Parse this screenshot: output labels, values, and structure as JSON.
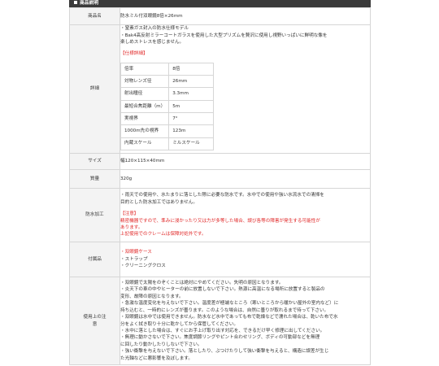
{
  "section_title": "商品説明",
  "rows": {
    "product_name": {
      "label": "商品名",
      "value": "防水ミル付双眼鏡8倍×26mm"
    },
    "details": {
      "label": "詳細",
      "bullets": [
        "・窒素ガス封入の防水仕様モデル",
        "・Bak4高反射ミラーコートガラスを使用した大型プリズムを贅沢に使用し視野いっぱいに鮮明な像を",
        "楽しめストレスを感じません。"
      ],
      "spec_heading": "【仕様詳細】",
      "spec_table": [
        {
          "key": "倍率",
          "value": "8倍"
        },
        {
          "key": "対物レンズ径",
          "value": "26mm"
        },
        {
          "key": "射出瞳径",
          "value": "3.3mm"
        },
        {
          "key": "最短合焦距離（m）",
          "value": "5m"
        },
        {
          "key": "実視界",
          "value": "7°"
        },
        {
          "key": "1000m先の視界",
          "value": "123m"
        },
        {
          "key": "内蔵スケール",
          "value": "ミルスケール"
        }
      ]
    },
    "size": {
      "label": "サイズ",
      "value": "幅120×115×40mm"
    },
    "weight": {
      "label": "質量",
      "value": "320g"
    },
    "waterproof": {
      "label": "防水加工",
      "lines": [
        "・雨天での使用や、水たまりに落とした際に必要な防水です。水中での使用や強い水流水での清掃を",
        "目的とした防水加工ではありません。"
      ],
      "notice_heading": "【注意】",
      "notice_lines": [
        "精密機器ですので、準みに浸かったり又は力が多等した場合、誤び各等の障害が発生する可能性が",
        "あります。",
        "上記使用でのクレームは保障対処外です。"
      ]
    },
    "accessories": {
      "label": "付属品",
      "lines": [
        "・双眼鏡ケース",
        "・ストラップ",
        "・クリーニングクロス"
      ]
    },
    "cautions": {
      "label_line1": "使用上の注",
      "label_line2": "意",
      "lines": [
        "・双眼鏡で太陽をのぞくことは絶対にやめてください。失明の原因となります。",
        "・炎天下の車の中やヒーターの前に放置しないで下さい。熱源に高温になる場所に放置すると製品の",
        "変形、故障の原因となります。",
        "・急激な温度変化を与えないで下さい。温度差が極端なところ（寒いところから暖かい屋外の室内など）に",
        "持ち込むと、一時的にレンズが曇ります。このような場合は、自然に曇りが取れるまで待って下さい。",
        "・双眼鏡は水中では使用できません。防水など水中であっても布で乾燥などで濡れた場合は、乾いた布で水",
        "分をよく拭き取り十分に乾かしてから保管してください。",
        "・水中に落とした場合は、すぐにお手上げ取り出す対応を、できるだけ早く修理に出してください。",
        "・無理に動かさないで下さい。焦度調節リングやピント合わせリング、ボディの可動部などを無理",
        "に回したり動かしたりしないで下さい。",
        "・強い衝撃を与えないで下さい。落としたり、ぶつけたりして強い衝撃を与えると、構造に誤差が生じ",
        "た光軸などに悪影響を及ぼします。"
      ]
    }
  }
}
